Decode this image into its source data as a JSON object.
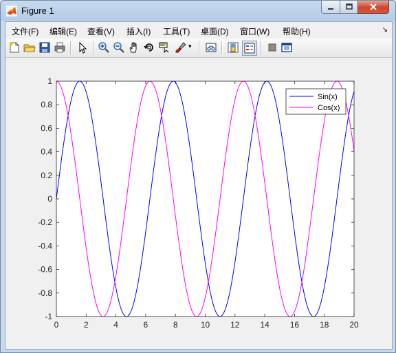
{
  "window": {
    "title": "Figure 1"
  },
  "menu": [
    {
      "label": "文件(F)",
      "name": "menu-file"
    },
    {
      "label": "编辑(E)",
      "name": "menu-edit"
    },
    {
      "label": "查看(V)",
      "name": "menu-view"
    },
    {
      "label": "插入(I)",
      "name": "menu-insert"
    },
    {
      "label": "工具(T)",
      "name": "menu-tools"
    },
    {
      "label": "桌面(D)",
      "name": "menu-desktop"
    },
    {
      "label": "窗口(W)",
      "name": "menu-window"
    },
    {
      "label": "帮助(H)",
      "name": "menu-help"
    }
  ],
  "toolbar": [
    "new-figure-icon",
    "open-file-icon",
    "save-icon",
    "print-icon",
    "edit-plot-arrow-icon",
    "zoom-in-icon",
    "zoom-out-icon",
    "pan-hand-icon",
    "rotate-3d-icon",
    "data-cursor-icon",
    "brush-icon",
    "link-plot-icon",
    "colorbar-icon",
    "legend-icon",
    "hide-plot-tools-icon",
    "show-plot-tools-icon"
  ],
  "colors": {
    "sin": "#0000ff",
    "cos": "#ff00ff"
  },
  "chart_data": {
    "type": "line",
    "title": "",
    "xlabel": "",
    "ylabel": "",
    "xlim": [
      0,
      20
    ],
    "ylim": [
      -1,
      1
    ],
    "xticks": [
      "0",
      "2",
      "4",
      "6",
      "8",
      "10",
      "12",
      "14",
      "16",
      "18",
      "20"
    ],
    "yticks": [
      "1",
      "0.8",
      "0.6",
      "0.4",
      "0.2",
      "0",
      "-0.2",
      "-0.4",
      "-0.6",
      "-0.8",
      "-1"
    ],
    "legend_position": "top-right",
    "grid": false,
    "series": [
      {
        "name": "Sin(x)",
        "function": "sin(x)",
        "color": "#0000ff"
      },
      {
        "name": "Cos(x)",
        "function": "cos(x)",
        "color": "#ff00ff"
      }
    ]
  }
}
